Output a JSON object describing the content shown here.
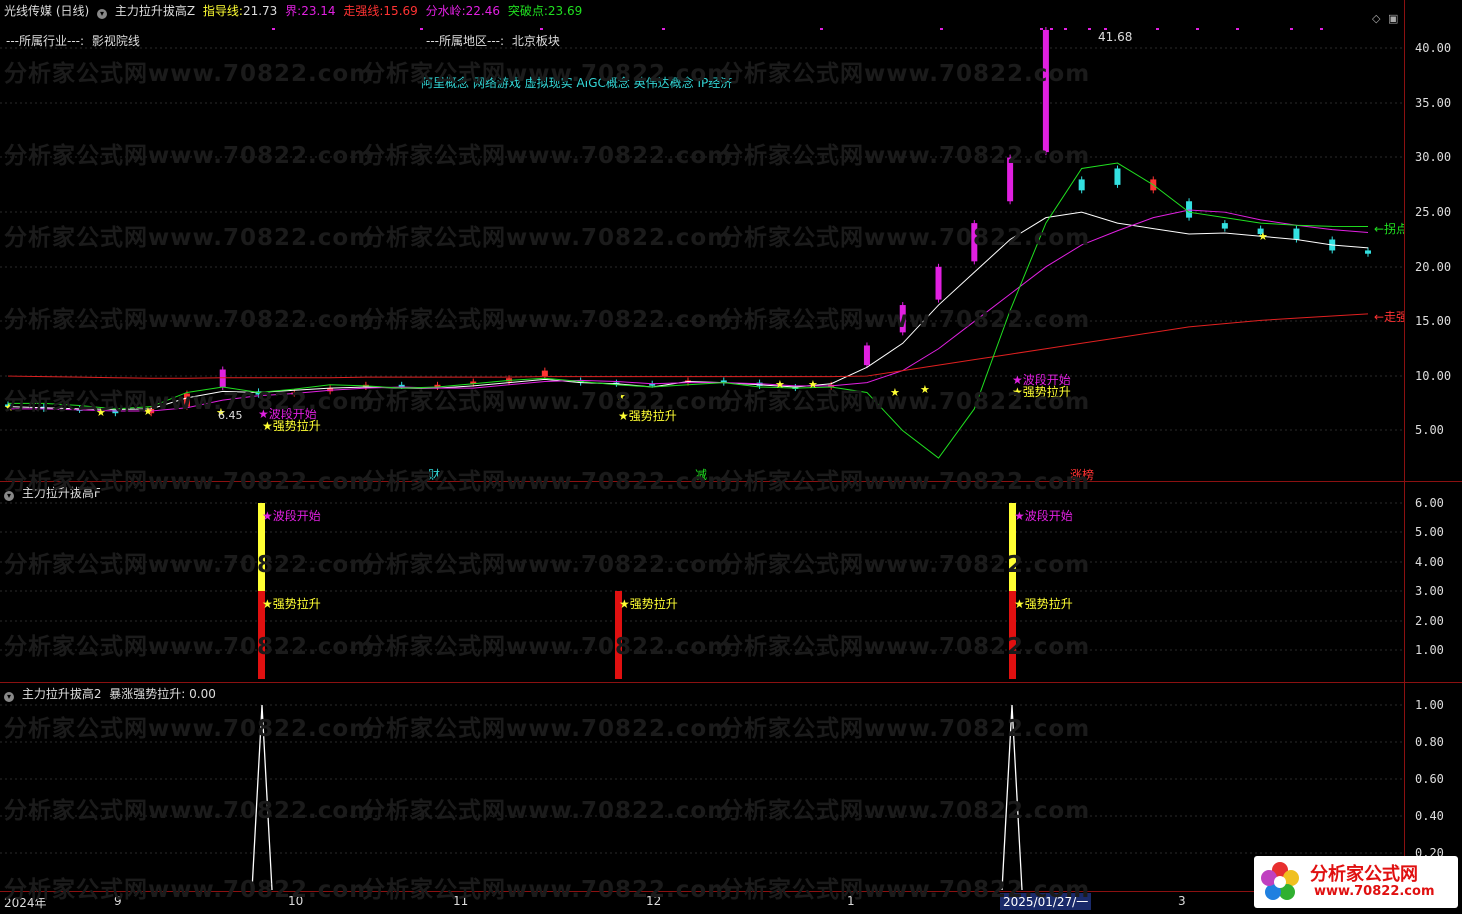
{
  "header": {
    "stock_name": "光线传媒 (日线)",
    "indicator_name": "主力拉升拔高Z",
    "guide_label": "指导线:",
    "guide_value": "21.73",
    "bound_label": "界:",
    "bound_value": "23.14",
    "strong_label": "走强线:",
    "strong_value": "15.69",
    "water_label": "分水岭:",
    "water_value": "22.46",
    "break_label": "突破点:",
    "break_value": "23.69"
  },
  "info": {
    "industry_label": "---所属行业---:",
    "industry_value": "影视院线",
    "region_label": "---所属地区---:",
    "region_value": "北京板块",
    "concepts": "阿里概念 网络游戏 虚拟现实 AIGC概念 英伟达概念 IP经济"
  },
  "main_axis": [
    "40.00",
    "35.00",
    "30.00",
    "25.00",
    "20.00",
    "15.00",
    "10.00",
    "5.00"
  ],
  "annotations": {
    "high_label": "41.68",
    "low_label": "6.45",
    "right_label_1": "←拐点",
    "right_label_2": "←走强",
    "tag_cai": "财",
    "tag_jian": "减",
    "tag_zhang": "涨榜"
  },
  "signals": {
    "wave_start": "★波段开始",
    "strong_rise": "★强势拉升"
  },
  "pane2": {
    "title": "主力拉升拔高F",
    "axis": [
      "6.00",
      "5.00",
      "4.00",
      "3.00",
      "2.00",
      "1.00"
    ]
  },
  "pane3": {
    "title": "主力拉升拔高2",
    "sub_label": "暴涨强势拉升:",
    "sub_value": "0.00",
    "axis": [
      "1.00",
      "0.80",
      "0.60",
      "0.40",
      "0.20"
    ]
  },
  "time_axis": [
    "2024年",
    "9",
    "10",
    "11",
    "12",
    "1",
    "2025/01/27/一",
    "3"
  ],
  "watermark": "分析家公式网www.70822.com",
  "brand": {
    "name": "分析家公式网",
    "url": "www.70822.com"
  },
  "colors": {
    "bull": "#ff3333",
    "bear": "#33e0e0",
    "magenta": "#e020e0",
    "yellow": "#ffff33",
    "green": "#20e020",
    "red_axis": "#8b1111"
  },
  "chart_data": {
    "type": "candlestick",
    "ylim": [
      2.5,
      42.5
    ],
    "series": [
      {
        "name": "指导线",
        "values": [
          7.2,
          7.1,
          7.0,
          6.95,
          7.0,
          8.0,
          8.6,
          8.5,
          8.7,
          8.9,
          9.0,
          8.9,
          8.9,
          9.1,
          9.4,
          9.7,
          9.4,
          9.3,
          9.0,
          9.5,
          9.4,
          9.2,
          9.0,
          9.3,
          10.8,
          13.0,
          16.5,
          19.5,
          22.5,
          24.5,
          25.0,
          24.0,
          23.5,
          23.0,
          23.1,
          22.8,
          22.5,
          22.0,
          21.73
        ]
      },
      {
        "name": "界",
        "values": [
          7.0,
          7.0,
          6.9,
          6.8,
          6.8,
          7.1,
          7.8,
          8.2,
          8.4,
          8.7,
          8.9,
          9.0,
          8.9,
          8.9,
          9.2,
          9.5,
          9.6,
          9.5,
          9.3,
          9.4,
          9.4,
          9.3,
          9.1,
          9.1,
          9.4,
          10.5,
          12.5,
          15.0,
          17.5,
          20.0,
          22.0,
          23.3,
          24.5,
          25.2,
          25.0,
          24.3,
          23.8,
          23.4,
          23.14
        ]
      },
      {
        "name": "走强线",
        "values": [
          10.0,
          9.95,
          9.9,
          9.85,
          9.8,
          9.8,
          9.85,
          9.85,
          9.85,
          9.85,
          9.9,
          9.9,
          9.9,
          9.9,
          9.9,
          9.95,
          9.95,
          9.95,
          9.95,
          9.95,
          9.95,
          9.95,
          9.95,
          9.95,
          10.0,
          10.5,
          11.0,
          11.5,
          12.0,
          12.5,
          13.0,
          13.5,
          14.0,
          14.5,
          14.8,
          15.1,
          15.3,
          15.5,
          15.69
        ]
      },
      {
        "name": "突破点",
        "values": [
          7.5,
          7.5,
          7.3,
          7.0,
          7.2,
          8.5,
          9.0,
          8.5,
          8.8,
          9.2,
          9.1,
          8.9,
          9.0,
          9.3,
          9.6,
          9.8,
          9.5,
          9.2,
          9.0,
          9.2,
          9.4,
          9.0,
          8.9,
          9.0,
          8.5,
          5.0,
          2.5,
          7.0,
          16.0,
          24.0,
          29.0,
          29.5,
          27.5,
          25.0,
          24.5,
          24.0,
          23.8,
          23.7,
          23.69
        ]
      }
    ],
    "candles": [
      {
        "o": 7.4,
        "c": 7.2
      },
      {
        "o": 7.2,
        "c": 7.0
      },
      {
        "o": 7.0,
        "c": 6.9
      },
      {
        "o": 6.9,
        "c": 6.6
      },
      {
        "o": 6.6,
        "c": 7.0
      },
      {
        "o": 7.2,
        "c": 8.4
      },
      {
        "o": 9.0,
        "c": 10.6
      },
      {
        "o": 8.6,
        "c": 8.3
      },
      {
        "o": 8.4,
        "c": 8.5
      },
      {
        "o": 8.6,
        "c": 8.9
      },
      {
        "o": 9.0,
        "c": 9.2
      },
      {
        "o": 9.2,
        "c": 9.1
      },
      {
        "o": 9.0,
        "c": 9.2
      },
      {
        "o": 9.3,
        "c": 9.5
      },
      {
        "o": 9.5,
        "c": 9.8
      },
      {
        "o": 10.0,
        "c": 10.5
      },
      {
        "o": 9.6,
        "c": 9.4
      },
      {
        "o": 9.4,
        "c": 9.3
      },
      {
        "o": 9.3,
        "c": 9.2
      },
      {
        "o": 9.4,
        "c": 9.6
      },
      {
        "o": 9.6,
        "c": 9.4
      },
      {
        "o": 9.4,
        "c": 9.1
      },
      {
        "o": 9.0,
        "c": 8.9
      },
      {
        "o": 9.0,
        "c": 9.2
      },
      {
        "o": 11.0,
        "c": 12.8
      },
      {
        "o": 14.0,
        "c": 16.5
      },
      {
        "o": 17.0,
        "c": 20.0
      },
      {
        "o": 20.5,
        "c": 24.0
      },
      {
        "o": 26.0,
        "c": 30.0
      },
      {
        "o": 30.5,
        "c": 41.68
      },
      {
        "o": 28.0,
        "c": 27.0
      },
      {
        "o": 29.0,
        "c": 27.5
      },
      {
        "o": 27.0,
        "c": 28.0
      },
      {
        "o": 26.0,
        "c": 24.5
      },
      {
        "o": 24.0,
        "c": 23.5
      },
      {
        "o": 23.5,
        "c": 23.0
      },
      {
        "o": 23.5,
        "c": 22.5
      },
      {
        "o": 22.5,
        "c": 21.5
      },
      {
        "o": 21.5,
        "c": 21.2
      }
    ],
    "pane2_bars": [
      {
        "t": "2024-09-30",
        "yellow": [
          3,
          6
        ],
        "red": [
          0,
          3
        ]
      },
      {
        "t": "2024-12",
        "yellow": null,
        "red": [
          0,
          3
        ]
      },
      {
        "t": "2025-01-27",
        "yellow": [
          3,
          6
        ],
        "red": [
          0,
          3
        ]
      }
    ],
    "pane3_spikes": [
      {
        "t": "2024-09-30",
        "v": 1.0
      },
      {
        "t": "2025-01-27",
        "v": 1.0
      }
    ]
  }
}
